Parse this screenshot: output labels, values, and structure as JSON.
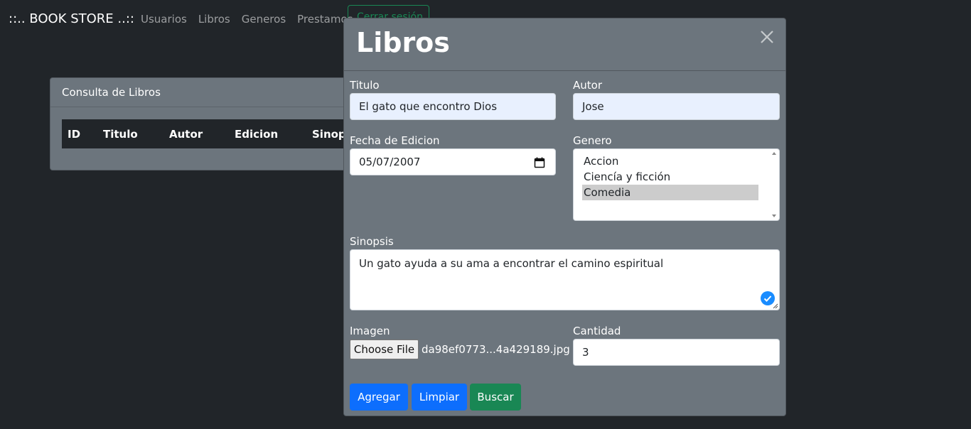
{
  "navbar": {
    "brand": "::.. BOOK STORE ..::",
    "links": [
      "Usuarios",
      "Libros",
      "Generos",
      "Prestamos"
    ],
    "session_button": "Cerrar sesión"
  },
  "card": {
    "title": "Consulta de Libros",
    "columns": [
      "ID",
      "Titulo",
      "Autor",
      "Edicion",
      "Sinop"
    ]
  },
  "modal": {
    "title": "Libros",
    "titulo": {
      "label": "Titulo",
      "value": "El gato que encontro  Dios"
    },
    "autor": {
      "label": "Autor",
      "value": "Jose"
    },
    "fecha": {
      "label": "Fecha de Edicion",
      "value": "05/07/2007"
    },
    "genero": {
      "label": "Genero",
      "options": [
        "Accion",
        "Ciencía y ficción",
        "Comedia"
      ],
      "selected": "Comedia"
    },
    "sinopsis": {
      "label": "Sinopsis",
      "value": "Un gato ayuda a su ama a encontrar el camino espiritual"
    },
    "imagen": {
      "label": "Imagen",
      "button": "Choose File",
      "file": "da98ef0773...4a429189.jpg"
    },
    "cantidad": {
      "label": "Cantidad",
      "value": "3"
    },
    "buttons": {
      "agregar": "Agregar",
      "limpiar": "Limpiar",
      "buscar": "Buscar"
    }
  },
  "colors": {
    "background": "#212529",
    "panel": "#6c757d",
    "primary": "#0d6efd",
    "success": "#198754"
  }
}
